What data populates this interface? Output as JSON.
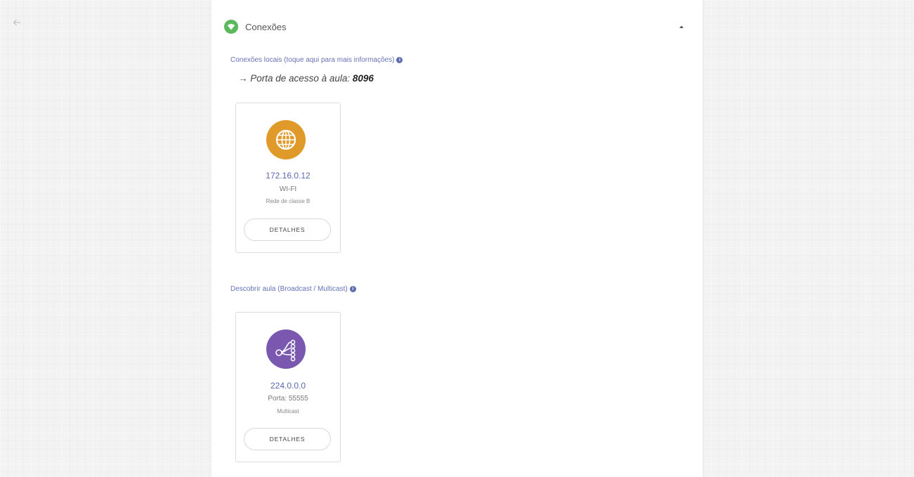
{
  "colors": {
    "accent": "#6673b5",
    "connections_icon": "#5cb85c",
    "wifi_icon": "#e09a2a",
    "multicast_icon": "#7a58b0"
  },
  "nav": {
    "back_icon": "arrow-left-icon"
  },
  "panel": {
    "title": "Conexões",
    "title_icon": "wifi-icon",
    "collapse_icon": "caret-up-icon"
  },
  "local": {
    "label": "Conexões locais (toque aqui para mais informações)",
    "info_icon": "info-icon",
    "port_arrow": "→",
    "port_label": "Porta de acesso à aula:",
    "port_value": "8096",
    "card": {
      "icon": "globe-icon",
      "ip": "172.16.0.12",
      "type": "WI-FI",
      "network_class": "Rede de classe B",
      "button_label": "DETALHES"
    }
  },
  "discover": {
    "label": "Descobrir aula (Broadcast / Multicast)",
    "info_icon": "info-icon",
    "card": {
      "icon": "multicast-icon",
      "ip": "224.0.0.0",
      "port": "Porta: 55555",
      "mode": "Multicast",
      "button_label": "DETALHES"
    }
  }
}
